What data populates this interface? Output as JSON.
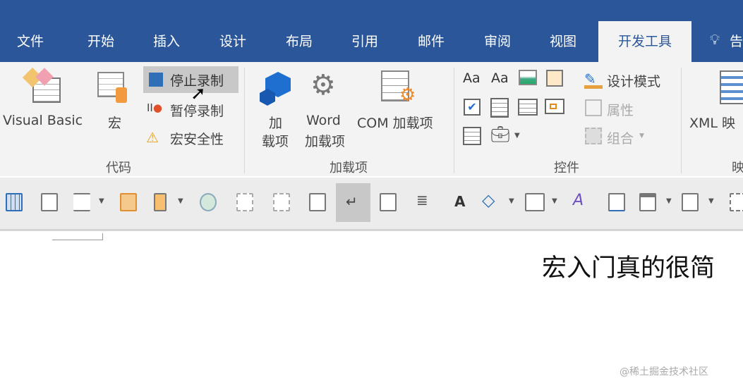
{
  "tabs": [
    "文件",
    "开始",
    "插入",
    "设计",
    "布局",
    "引用",
    "邮件",
    "审阅",
    "视图"
  ],
  "active_tab": "开发工具",
  "tell_me": "告",
  "code_group": {
    "label": "代码",
    "visual_basic": "Visual Basic",
    "macros": "宏",
    "stop_recording": "停止录制",
    "pause_recording": "暂停录制",
    "macro_security": "宏安全性"
  },
  "addins_group": {
    "label": "加载项",
    "addins_line1": "加",
    "addins_line2": "载项",
    "word_addins_line1": "Word",
    "word_addins_line2": "加载项",
    "com_addins": "COM 加载项"
  },
  "controls_group": {
    "label": "控件",
    "design_mode": "设计模式",
    "properties": "属性",
    "group": "组合"
  },
  "mapping_group": {
    "label": "映",
    "xml_mapping": "XML 映"
  },
  "document": {
    "text": "宏入门真的很简"
  },
  "watermark": "@稀土掘金技术社区",
  "colors": {
    "title_bar": "#2b579a",
    "ribbon": "#f3f3f3"
  }
}
